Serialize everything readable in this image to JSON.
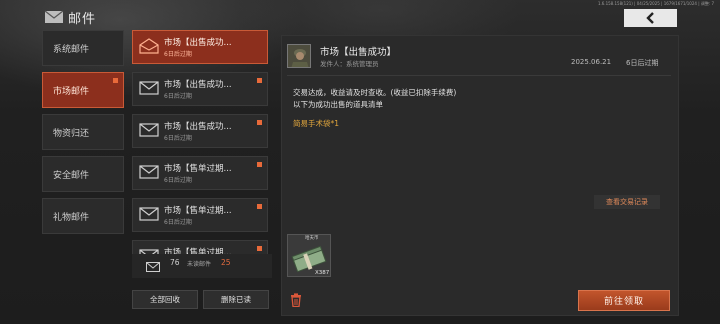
{
  "header": {
    "title": "邮件",
    "build_info": "1.6.158.158(121) | 04/25/2025 | 1679/1671/1024 | 调整: 7"
  },
  "categories": [
    {
      "label": "系统邮件",
      "active": false,
      "unread": false
    },
    {
      "label": "市场邮件",
      "active": true,
      "unread": true
    },
    {
      "label": "物资归还",
      "active": false,
      "unread": false
    },
    {
      "label": "安全邮件",
      "active": false,
      "unread": false
    },
    {
      "label": "礼物邮件",
      "active": false,
      "unread": false
    }
  ],
  "mails": [
    {
      "title": "市场【出售成功...",
      "sub": "6日后过期",
      "active": true,
      "opened": true,
      "unread": false
    },
    {
      "title": "市场【出售成功...",
      "sub": "6日后过期",
      "active": false,
      "opened": false,
      "unread": true
    },
    {
      "title": "市场【出售成功...",
      "sub": "6日后过期",
      "active": false,
      "opened": false,
      "unread": true
    },
    {
      "title": "市场【售单过期...",
      "sub": "6日后过期",
      "active": false,
      "opened": false,
      "unread": true
    },
    {
      "title": "市场【售单过期...",
      "sub": "6日后过期",
      "active": false,
      "opened": false,
      "unread": true
    },
    {
      "title": "市场【售单过期...",
      "sub": "",
      "active": false,
      "opened": false,
      "unread": true
    }
  ],
  "footer": {
    "mail_count": "76",
    "unread_label": "未读邮件",
    "unread_count": "25",
    "collect_all": "全部回收",
    "delete_read": "删除已读"
  },
  "detail": {
    "title": "市场【出售成功】",
    "sender": "发件人：系统管理员",
    "date": "2025.06.21",
    "expire": "6日后过期",
    "body_line1": "交易达成，收益请及时查收。(收益已扣除手续费)",
    "body_line2": "以下为成功出售的道具清单",
    "item_line": "简易手术袋*1",
    "view_trades": "查看交易记录",
    "attachment_caption": "哈夫币",
    "attachment_qty": "X387",
    "claim": "前往领取"
  },
  "colors": {
    "accent": "#8c2f1d",
    "accent_border": "#c95a37",
    "unread_dot": "#e86a3a",
    "item_text": "#e0a53c"
  }
}
